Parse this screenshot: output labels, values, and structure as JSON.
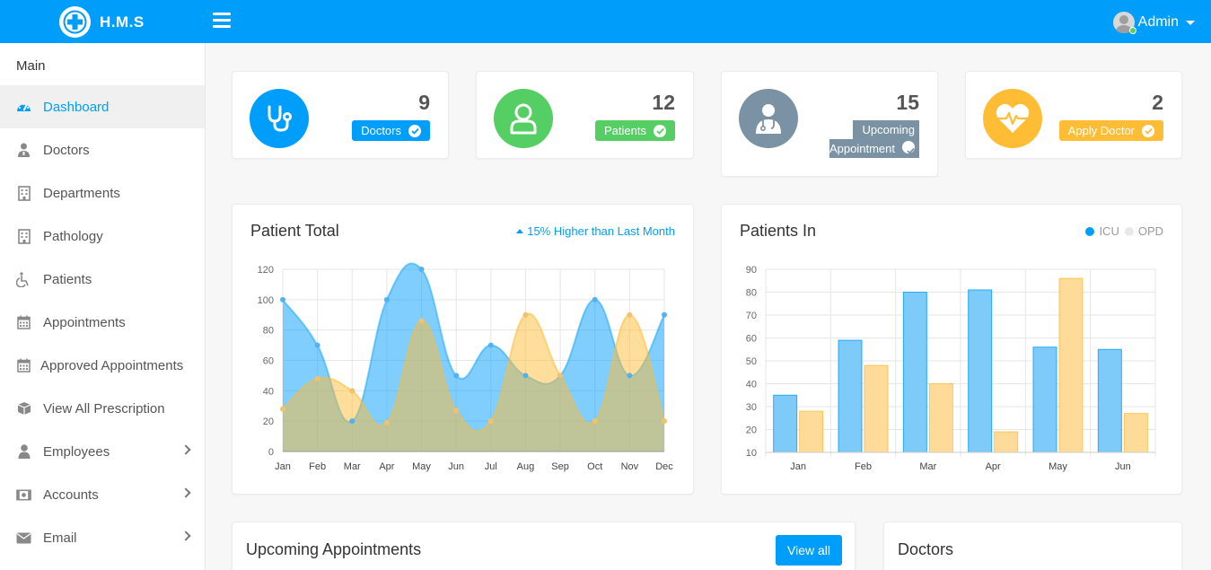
{
  "app": {
    "title": "H.M.S"
  },
  "user": {
    "name": "Admin"
  },
  "sidebar": {
    "section_title": "Main",
    "items": [
      {
        "label": "Dashboard",
        "icon": "dashboard-icon",
        "active": true
      },
      {
        "label": "Doctors",
        "icon": "user-doctor-icon"
      },
      {
        "label": "Departments",
        "icon": "hospital-icon"
      },
      {
        "label": "Pathology",
        "icon": "hospital-icon"
      },
      {
        "label": "Patients",
        "icon": "wheelchair-icon"
      },
      {
        "label": "Appointments",
        "icon": "calendar-icon"
      },
      {
        "label": "Approved Appointments",
        "icon": "calendar-icon"
      },
      {
        "label": "View All Prescription",
        "icon": "cube-icon"
      },
      {
        "label": "Employees",
        "icon": "user-icon",
        "submenu": true
      },
      {
        "label": "Accounts",
        "icon": "money-icon",
        "submenu": true
      },
      {
        "label": "Email",
        "icon": "envelope-icon",
        "submenu": true
      }
    ]
  },
  "stats": [
    {
      "value": "9",
      "label": "Doctors",
      "color": "#009efb",
      "icon": "stethoscope-icon"
    },
    {
      "value": "12",
      "label": "Patients",
      "color": "#55ce63",
      "icon": "user-outline-icon"
    },
    {
      "value": "15",
      "label_line1": "Upcoming",
      "label_line2": "Appointment",
      "color": "#7a92a3",
      "icon": "user-md-icon"
    },
    {
      "value": "2",
      "label": "Apply Doctor",
      "color": "#ffbc35",
      "icon": "heartbeat-icon"
    }
  ],
  "patient_total": {
    "title": "Patient Total",
    "note": "15% Higher than Last Month"
  },
  "patients_in": {
    "title": "Patients In",
    "legend": [
      "ICU",
      "OPD"
    ]
  },
  "upcoming": {
    "title": "Upcoming Appointments",
    "button": "View all"
  },
  "doctors_panel": {
    "title": "Doctors"
  },
  "colors": {
    "primary": "#009efb",
    "icu": "#7ecbf9",
    "opd": "#ffdb9a"
  },
  "chart_data": [
    {
      "type": "area",
      "title": "Patient Total",
      "categories": [
        "Jan",
        "Feb",
        "Mar",
        "Apr",
        "May",
        "Jun",
        "Jul",
        "Aug",
        "Sep",
        "Oct",
        "Nov",
        "Dec"
      ],
      "ylim": [
        0,
        120
      ],
      "yticks": [
        0,
        20,
        40,
        60,
        80,
        100,
        120
      ],
      "grid": true,
      "series": [
        {
          "values": [
            100,
            70,
            20,
            100,
            120,
            50,
            70,
            50,
            50,
            100,
            50,
            90
          ],
          "color": "#009efb"
        },
        {
          "values": [
            28,
            48,
            40,
            19,
            86,
            27,
            20,
            90,
            50,
            20,
            90,
            20
          ],
          "color": "#ffbc35"
        }
      ]
    },
    {
      "type": "bar",
      "title": "Patients In",
      "categories": [
        "Jan",
        "Feb",
        "Mar",
        "Apr",
        "May",
        "Jun"
      ],
      "ylim": [
        10,
        90
      ],
      "yticks": [
        10,
        20,
        30,
        40,
        50,
        60,
        70,
        80,
        90
      ],
      "grid": true,
      "legend": "top-right",
      "series": [
        {
          "name": "ICU",
          "values": [
            35,
            59,
            80,
            81,
            56,
            55
          ],
          "color": "#7ecbf9"
        },
        {
          "name": "OPD",
          "values": [
            28,
            48,
            40,
            19,
            86,
            27
          ],
          "color": "#ffdb9a"
        }
      ]
    }
  ]
}
